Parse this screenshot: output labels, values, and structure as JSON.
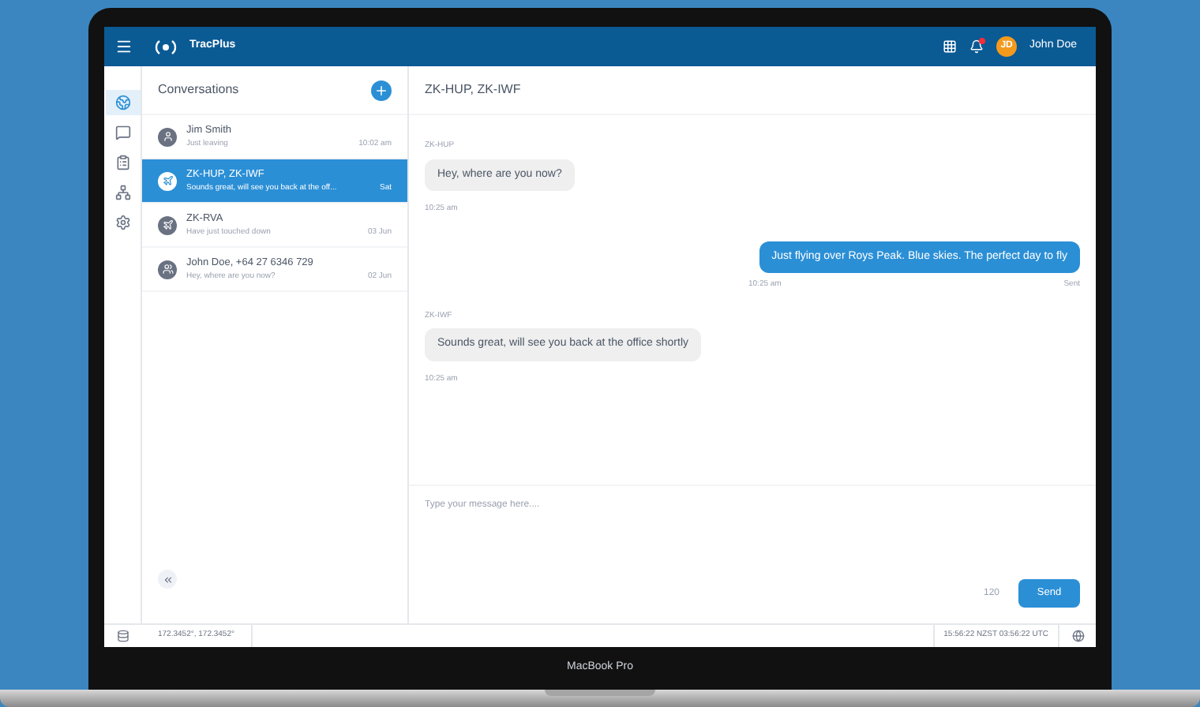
{
  "app": {
    "title": "TracPlus",
    "user": {
      "initials": "JD",
      "name": "John Doe"
    },
    "notifications": true
  },
  "sidebar": {
    "items": [
      {
        "kind": "globe",
        "selected": true
      },
      {
        "kind": "chat",
        "selected": false
      },
      {
        "kind": "list",
        "selected": false
      },
      {
        "kind": "group",
        "selected": false
      },
      {
        "kind": "settings",
        "selected": false
      }
    ]
  },
  "conversations": {
    "title": "Conversations",
    "items": [
      {
        "kind": "person",
        "name": "Jim Smith",
        "preview": "Just leaving",
        "time": "10:02 am",
        "selected": false
      },
      {
        "kind": "aircraft-group",
        "name": "ZK-HUP, ZK-IWF",
        "preview": "Sounds great, will see you back at the off...",
        "time": "Sat",
        "selected": true
      },
      {
        "kind": "aircraft",
        "name": "ZK-RVA",
        "preview": "Have just touched down",
        "time": "03 Jun",
        "selected": false
      },
      {
        "kind": "person-group",
        "name": "John Doe, +64 27 6346 729",
        "preview": "Hey, where are you now?",
        "time": "02 Jun",
        "selected": false
      }
    ]
  },
  "chat": {
    "title": "ZK-HUP, ZK-IWF",
    "messages": [
      {
        "kind": "received",
        "sender": "ZK-HUP",
        "text": "Hey, where are you now?",
        "time": "10:25 am"
      },
      {
        "kind": "sent",
        "text": "Just flying over Roys Peak. Blue skies. The perfect day to fly",
        "time": "10:25 am",
        "status": "Sent"
      },
      {
        "kind": "received",
        "sender": "ZK-IWF",
        "text": "Sounds great, will see you back at the office shortly",
        "time": "10:25 am"
      }
    ],
    "composer": {
      "placeholder": "Type your message here....",
      "count": "120",
      "send": "Send"
    }
  },
  "status_bar": {
    "coordinates": "172.3452°, 172.3452°",
    "time": "15:56:22 NZST 03:56:22 UTC"
  },
  "device": {
    "label": "MacBook Pro"
  }
}
